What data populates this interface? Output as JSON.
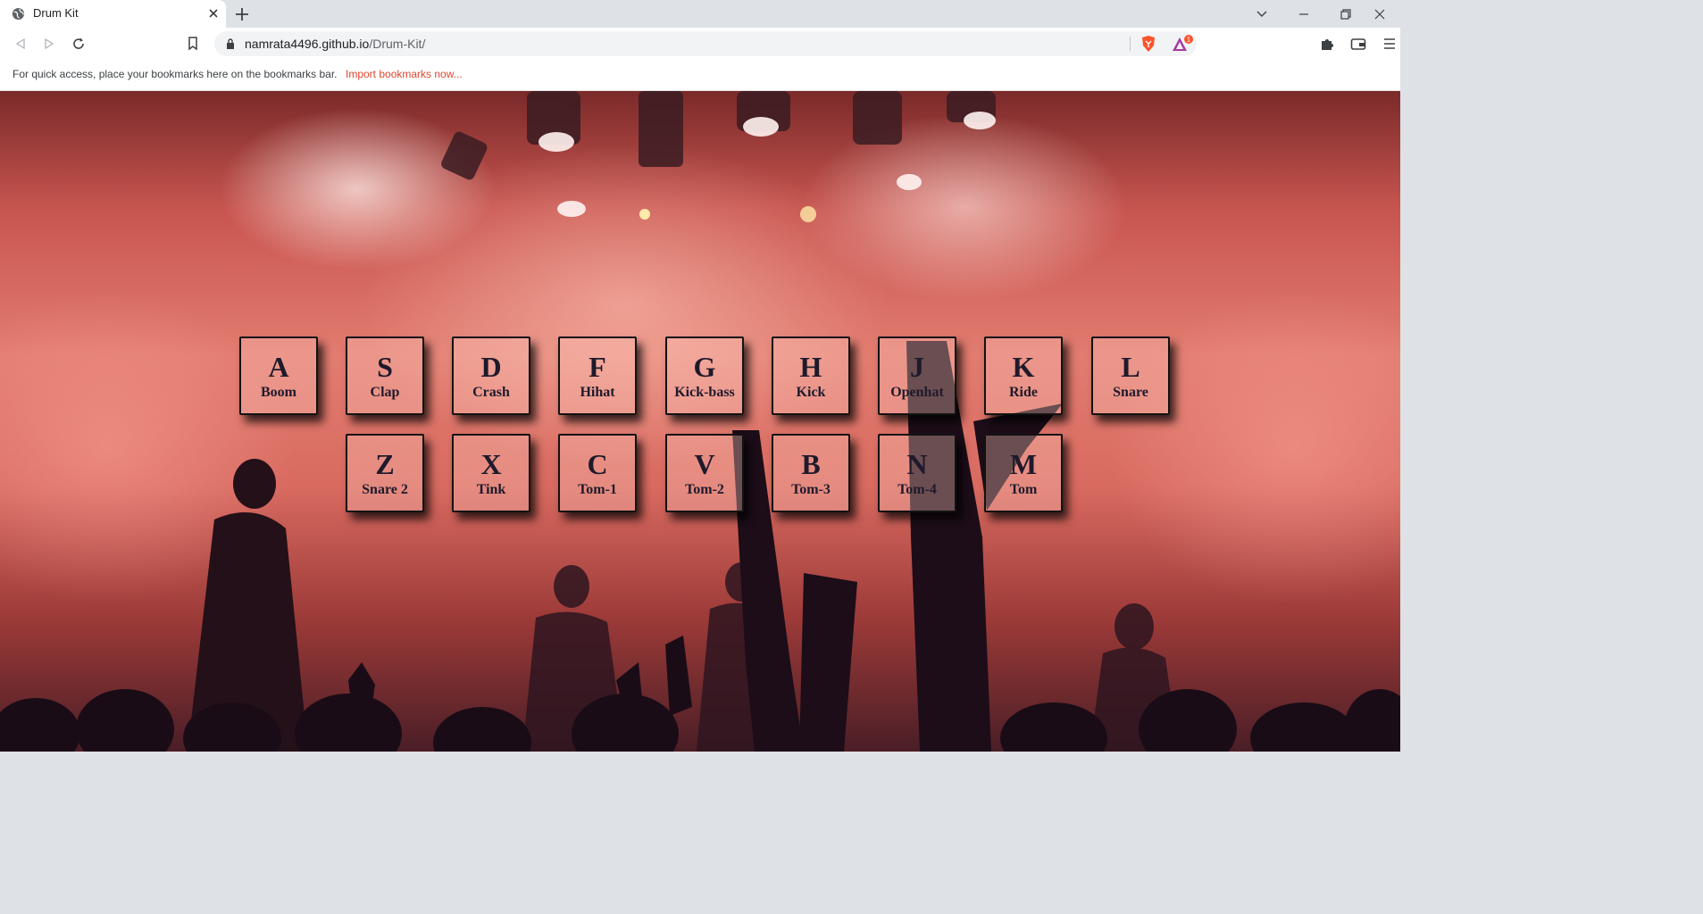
{
  "browser": {
    "tab_title": "Drum Kit",
    "url_host": "namrata4496.github.io",
    "url_path": "/Drum-Kit/",
    "rewards_badge": "1"
  },
  "bookmarks_bar": {
    "message": "For quick access, place your bookmarks here on the bookmarks bar.",
    "import_link": "Import bookmarks now..."
  },
  "drum_keys": [
    {
      "key": "A",
      "sound": "Boom"
    },
    {
      "key": "S",
      "sound": "Clap"
    },
    {
      "key": "D",
      "sound": "Crash"
    },
    {
      "key": "F",
      "sound": "Hihat"
    },
    {
      "key": "G",
      "sound": "Kick-bass"
    },
    {
      "key": "H",
      "sound": "Kick"
    },
    {
      "key": "J",
      "sound": "Openhat"
    },
    {
      "key": "K",
      "sound": "Ride"
    },
    {
      "key": "L",
      "sound": "Snare"
    },
    {
      "key": "Z",
      "sound": "Snare 2"
    },
    {
      "key": "X",
      "sound": "Tink"
    },
    {
      "key": "C",
      "sound": "Tom-1"
    },
    {
      "key": "V",
      "sound": "Tom-2"
    },
    {
      "key": "B",
      "sound": "Tom-3"
    },
    {
      "key": "N",
      "sound": "Tom-4"
    },
    {
      "key": "M",
      "sound": "Tom"
    }
  ]
}
